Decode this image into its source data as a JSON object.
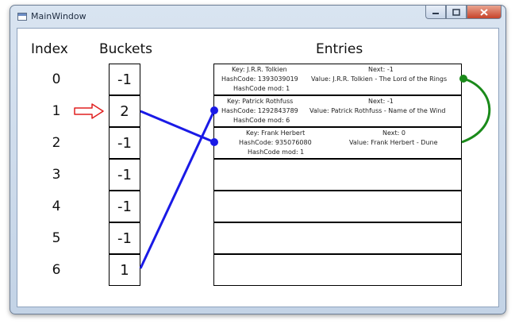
{
  "window": {
    "title": "MainWindow",
    "buttons": {
      "minimize_icon": "minimize-icon",
      "maximize_icon": "maximize-icon",
      "close_icon": "close-icon"
    }
  },
  "headers": {
    "index": "Index",
    "buckets": "Buckets",
    "entries": "Entries"
  },
  "indices": [
    "0",
    "1",
    "2",
    "3",
    "4",
    "5",
    "6"
  ],
  "buckets": [
    "-1",
    "2",
    "-1",
    "-1",
    "-1",
    "-1",
    "1"
  ],
  "highlighted_index": "1",
  "entries": [
    {
      "key": "Key: J.R.R. Tolkien",
      "hashcode": "HashCode: 1393039019",
      "mod": "HashCode mod: 1",
      "next": "Next: -1",
      "value": "Value: J.R.R. Tolkien - The Lord of the Rings"
    },
    {
      "key": "Key: Patrick Rothfuss",
      "hashcode": "HashCode: 1292843789",
      "mod": "HashCode mod: 6",
      "next": "Next: -1",
      "value": "Value: Patrick Rothfuss - Name of the Wind"
    },
    {
      "key": "Key: Frank Herbert",
      "hashcode": "HashCode: 935076080",
      "mod": "HashCode mod: 1",
      "next": "Next: 0",
      "value": "Value: Frank Herbert - Dune"
    },
    {
      "key": "",
      "hashcode": "",
      "mod": "",
      "next": "",
      "value": ""
    },
    {
      "key": "",
      "hashcode": "",
      "mod": "",
      "next": "",
      "value": ""
    },
    {
      "key": "",
      "hashcode": "",
      "mod": "",
      "next": "",
      "value": ""
    },
    {
      "key": "",
      "hashcode": "",
      "mod": "",
      "next": "",
      "value": ""
    }
  ],
  "colors": {
    "bucket_link": "#1a1ae6",
    "next_link": "#1a8a1a",
    "arrow": "#e02020"
  }
}
